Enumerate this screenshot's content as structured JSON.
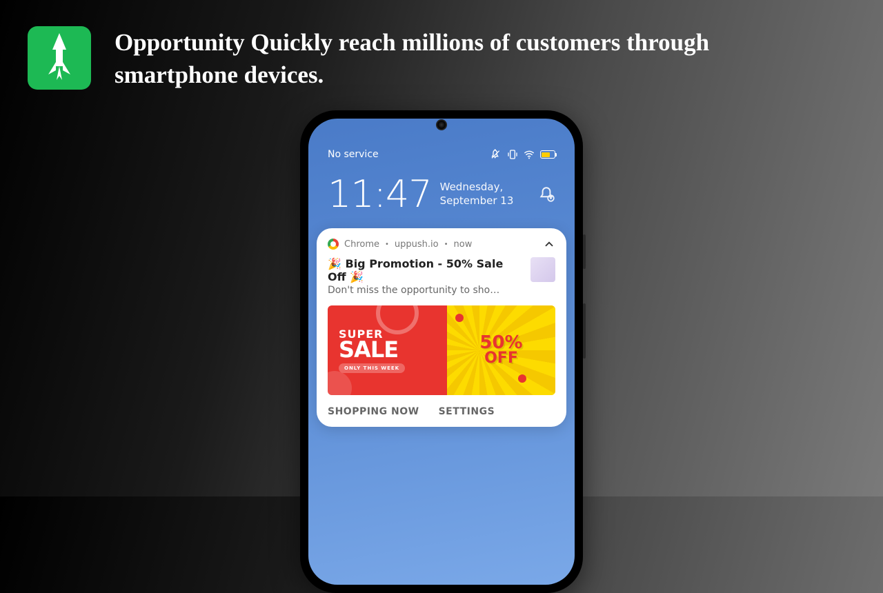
{
  "header": {
    "title": "Opportunity Quickly reach millions of customers through smartphone devices."
  },
  "status": {
    "carrier": "No service"
  },
  "lockscreen": {
    "time": "11:47",
    "date": "Wednesday, September 13"
  },
  "notification": {
    "app": "Chrome",
    "source": "uppush.io",
    "timestamp": "now",
    "title": "🎉 Big Promotion - 50% Sale Off 🎉",
    "body": "Don't miss the opportunity to shop with expl..",
    "action_primary": "SHOPPING NOW",
    "action_secondary": "SETTINGS"
  },
  "banner": {
    "line1": "SUPER",
    "line2": "SALE",
    "badge": "ONLY THIS WEEK",
    "pct": "50%",
    "off": "OFF"
  }
}
